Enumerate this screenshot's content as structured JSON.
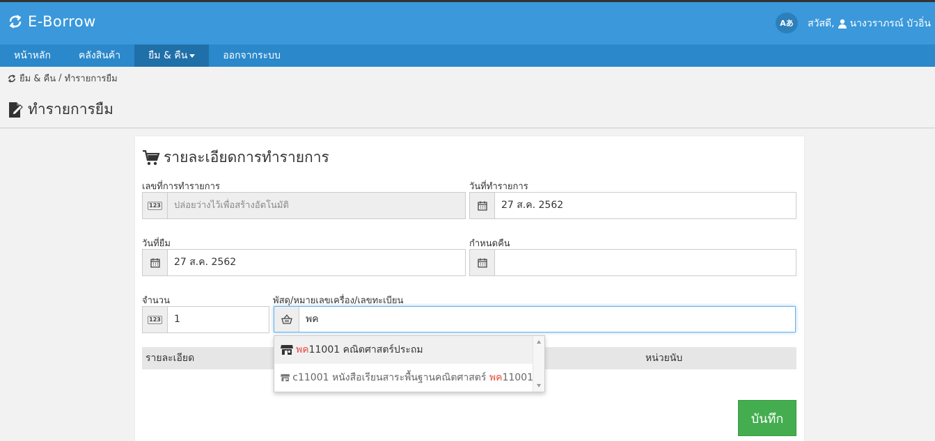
{
  "app": {
    "title": "E-Borrow",
    "lang_label": "Aあ",
    "greeting": "สวัสดี,",
    "user_name": "นางวราภรณ์ บัวอิ่น"
  },
  "nav": {
    "items": [
      {
        "label": "หน้าหลัก"
      },
      {
        "label": "คลังสินค้า"
      },
      {
        "label": "ยืม & คืน"
      },
      {
        "label": "ออกจากระบบ"
      }
    ]
  },
  "breadcrumb": {
    "parent": "ยืม & คืน",
    "separator": "/",
    "current": "ทำรายการยืม"
  },
  "page": {
    "title": "ทำรายการยืม"
  },
  "form": {
    "title": "รายละเอียดการทำรายการ",
    "transaction_no": {
      "label": "เลขที่การทำรายการ",
      "placeholder": "ปล่อยว่างไว้เพื่อสร้างอัตโนมัติ"
    },
    "transaction_date": {
      "label": "วันที่ทำรายการ",
      "value": "27 ส.ค. 2562"
    },
    "borrow_date": {
      "label": "วันที่ยืม",
      "value": "27 ส.ค. 2562"
    },
    "due_date": {
      "label": "กำหนดคืน",
      "value": ""
    },
    "quantity": {
      "label": "จำนวน",
      "value": "1"
    },
    "item": {
      "label": "พัสดุ/หมายเลขเครื่อง/เลขทะเบียน",
      "value": "พค"
    },
    "table": {
      "col_detail": "รายละเอียด",
      "col_unit": "หน่วยนับ"
    },
    "save_label": "บันทึก"
  },
  "autocomplete": {
    "items": [
      {
        "match": "พค",
        "rest": "11001 คณิตศาสตร์ประถม"
      },
      {
        "prefix": "c11001 หนังสือเรียนสาระพื้นฐานคณิตศาสตร์ ",
        "match": "พค",
        "suffix": "11001"
      }
    ]
  },
  "colors": {
    "header": "#3a98db",
    "nav": "#2a88cb",
    "nav_active": "#1f6fa9",
    "save": "#44ad4f",
    "highlight": "#e74c3c"
  }
}
